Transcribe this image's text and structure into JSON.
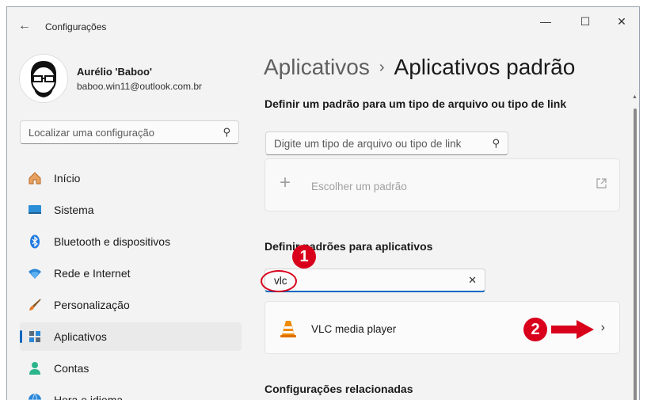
{
  "window": {
    "title": "Configurações",
    "controls": {
      "minimize": "—",
      "maximize": "☐",
      "close": "✕"
    }
  },
  "user": {
    "name": "Aurélio 'Baboo'",
    "email": "baboo.win11@outlook.com.br"
  },
  "sidebar": {
    "search_placeholder": "Localizar uma configuração",
    "items": [
      {
        "label": "Início",
        "icon": "home-icon"
      },
      {
        "label": "Sistema",
        "icon": "system-icon"
      },
      {
        "label": "Bluetooth e dispositivos",
        "icon": "bluetooth-icon"
      },
      {
        "label": "Rede e Internet",
        "icon": "wifi-icon"
      },
      {
        "label": "Personalização",
        "icon": "brush-icon"
      },
      {
        "label": "Aplicativos",
        "icon": "apps-icon",
        "selected": true
      },
      {
        "label": "Contas",
        "icon": "account-icon"
      },
      {
        "label": "Hora e idioma",
        "icon": "globe-icon"
      }
    ]
  },
  "breadcrumb": {
    "parent": "Aplicativos",
    "separator": "›",
    "current": "Aplicativos padrão"
  },
  "file_type_section": {
    "heading": "Definir um padrão para um tipo de arquivo ou tipo de link",
    "search_placeholder": "Digite um tipo de arquivo ou tipo de link",
    "choose_label": "Escolher um padrão"
  },
  "app_section": {
    "heading": "Definir padrões para aplicativos",
    "search_value": "vlc",
    "results": [
      {
        "name": "VLC media player"
      }
    ]
  },
  "related_section": {
    "heading": "Configurações relacionadas"
  },
  "annotations": {
    "badge_1": "1",
    "badge_2": "2",
    "color": "#d9001b"
  },
  "colors": {
    "accent": "#0067c0",
    "background": "#f3f3f3"
  }
}
